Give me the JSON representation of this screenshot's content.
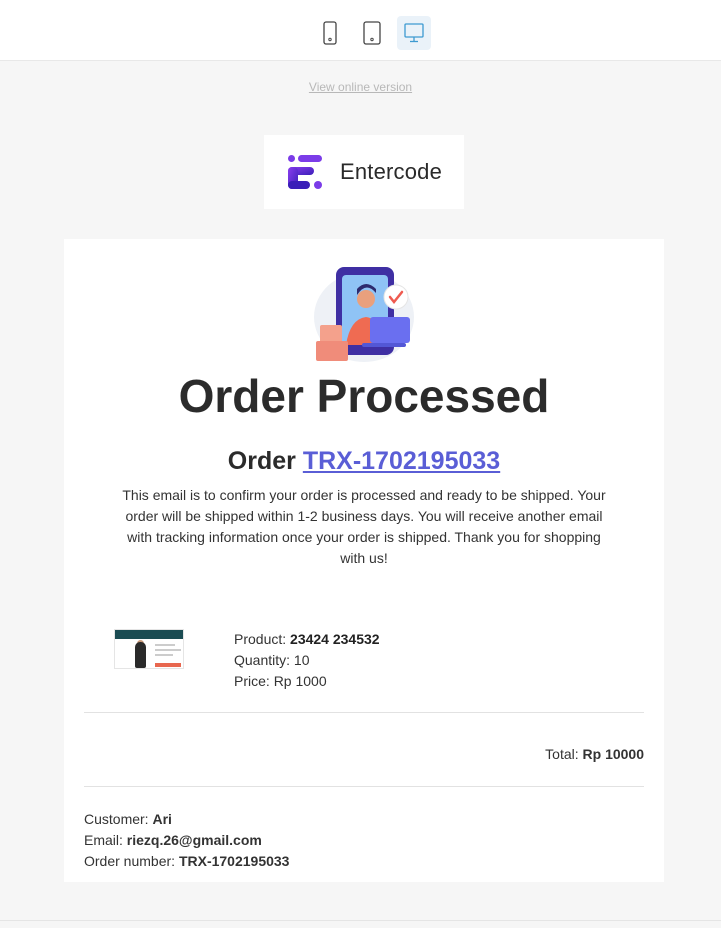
{
  "toolbar": {
    "devices": [
      {
        "name": "mobile",
        "icon": "mobile-icon",
        "active": false
      },
      {
        "name": "tablet",
        "icon": "tablet-icon",
        "active": false
      },
      {
        "name": "desktop",
        "icon": "desktop-icon",
        "active": true
      }
    ]
  },
  "email": {
    "view_online": "View online version",
    "logo_text": "Entercode",
    "title": "Order Processed",
    "order_label": "Order",
    "order_id": "TRX-1702195033",
    "message": "This email is to confirm your order is processed and ready to be shipped. Your order will be shipped within 1-2 business days. You will receive another email with tracking information once your order is shipped. Thank you for shopping with us!",
    "product": {
      "product_label": "Product:",
      "product_value": "23424 234532",
      "quantity_label": "Quantity:",
      "quantity_value": "10",
      "price_label": "Price:",
      "price_value": "Rp 1000"
    },
    "total_label": "Total:",
    "total_value": "Rp 10000",
    "customer": {
      "customer_label": "Customer:",
      "customer_value": "Ari",
      "email_label": "Email:",
      "email_value": "riezq.26@gmail.com",
      "order_number_label": "Order number:",
      "order_number_value": "TRX-1702195033"
    }
  },
  "colors": {
    "accent": "#5a5ed6",
    "brand": "#5b2bd6",
    "active_device": "#3d9ad1"
  }
}
